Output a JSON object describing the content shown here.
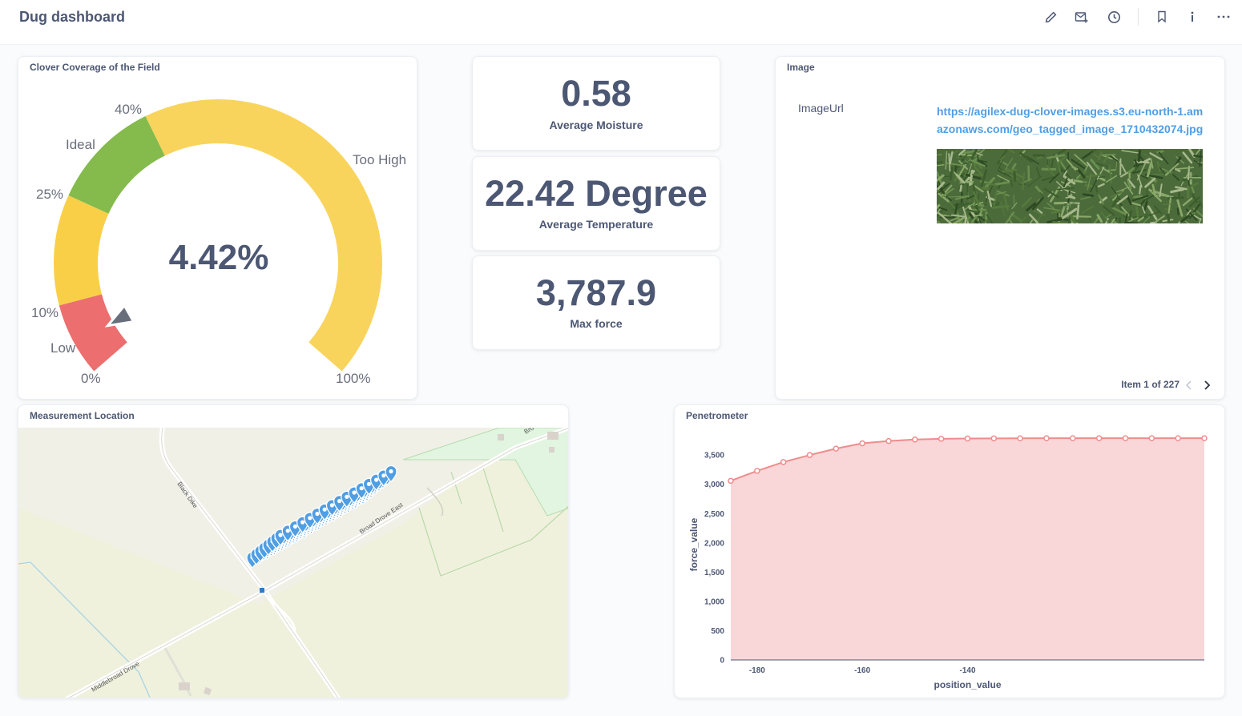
{
  "header": {
    "title": "Dug dashboard",
    "actions": [
      "pencil-icon",
      "subscription-icon",
      "history-icon",
      "bookmark-icon",
      "info-icon",
      "more-icon"
    ]
  },
  "gauge": {
    "title": "Clover Coverage of the Field",
    "value": 4.42,
    "value_label": "4.42%",
    "ticks": [
      "0%",
      "10%",
      "25%",
      "40%",
      "100%"
    ],
    "segments": [
      {
        "label": "Low",
        "from": 0,
        "to": 10,
        "color": "#ed6e6e"
      },
      {
        "label": "",
        "from": 10,
        "to": 25,
        "color": "#f9cf48"
      },
      {
        "label": "Ideal",
        "from": 25,
        "to": 40,
        "color": "#84bb4c"
      },
      {
        "label": "Too High",
        "from": 40,
        "to": 100,
        "color": "#f9d45c"
      }
    ],
    "pointer_color": "#696e7b"
  },
  "scalars": [
    {
      "value": "0.58",
      "label": "Average Moisture"
    },
    {
      "value": "22.42 Degree",
      "label": "Average Temperature"
    },
    {
      "value": "3,787.9",
      "label": "Max force"
    }
  ],
  "image_card": {
    "title": "Image",
    "key": "ImageUrl",
    "url": "https://agilex-dug-clover-images.s3.eu-north-1.amazonaws.com/geo_tagged_image_1710432074.jpg",
    "pager": "Item 1 of 227"
  },
  "map": {
    "title": "Measurement Location",
    "roads": [
      "Black Dike",
      "Broad Drove East",
      "Middlebroad Drove",
      "Bro"
    ],
    "pin_color": "#509ee3"
  },
  "penetrometer": {
    "title": "Penetrometer",
    "chart_data": {
      "type": "area",
      "x": [
        -185,
        -180,
        -175,
        -170,
        -165,
        -160,
        -155,
        -150,
        -145,
        -140,
        -135,
        -130,
        -125,
        -120,
        -115,
        -110,
        -105,
        -100,
        -95
      ],
      "values": [
        3060,
        3230,
        3380,
        3500,
        3610,
        3700,
        3740,
        3765,
        3778,
        3782,
        3785,
        3786,
        3787,
        3787.5,
        3787.7,
        3787.8,
        3787.9,
        3787.9,
        3787.9
      ],
      "xlabel": "position_value",
      "ylabel": "force_value",
      "ylim": [
        0,
        3750
      ],
      "yticks": [
        "0",
        "500",
        "1,000",
        "1,500",
        "2,000",
        "2,500",
        "3,000",
        "3,500"
      ],
      "xticks": [
        "-180",
        "-160",
        "-140"
      ],
      "color": "#ef8c8c",
      "grid": false
    }
  }
}
